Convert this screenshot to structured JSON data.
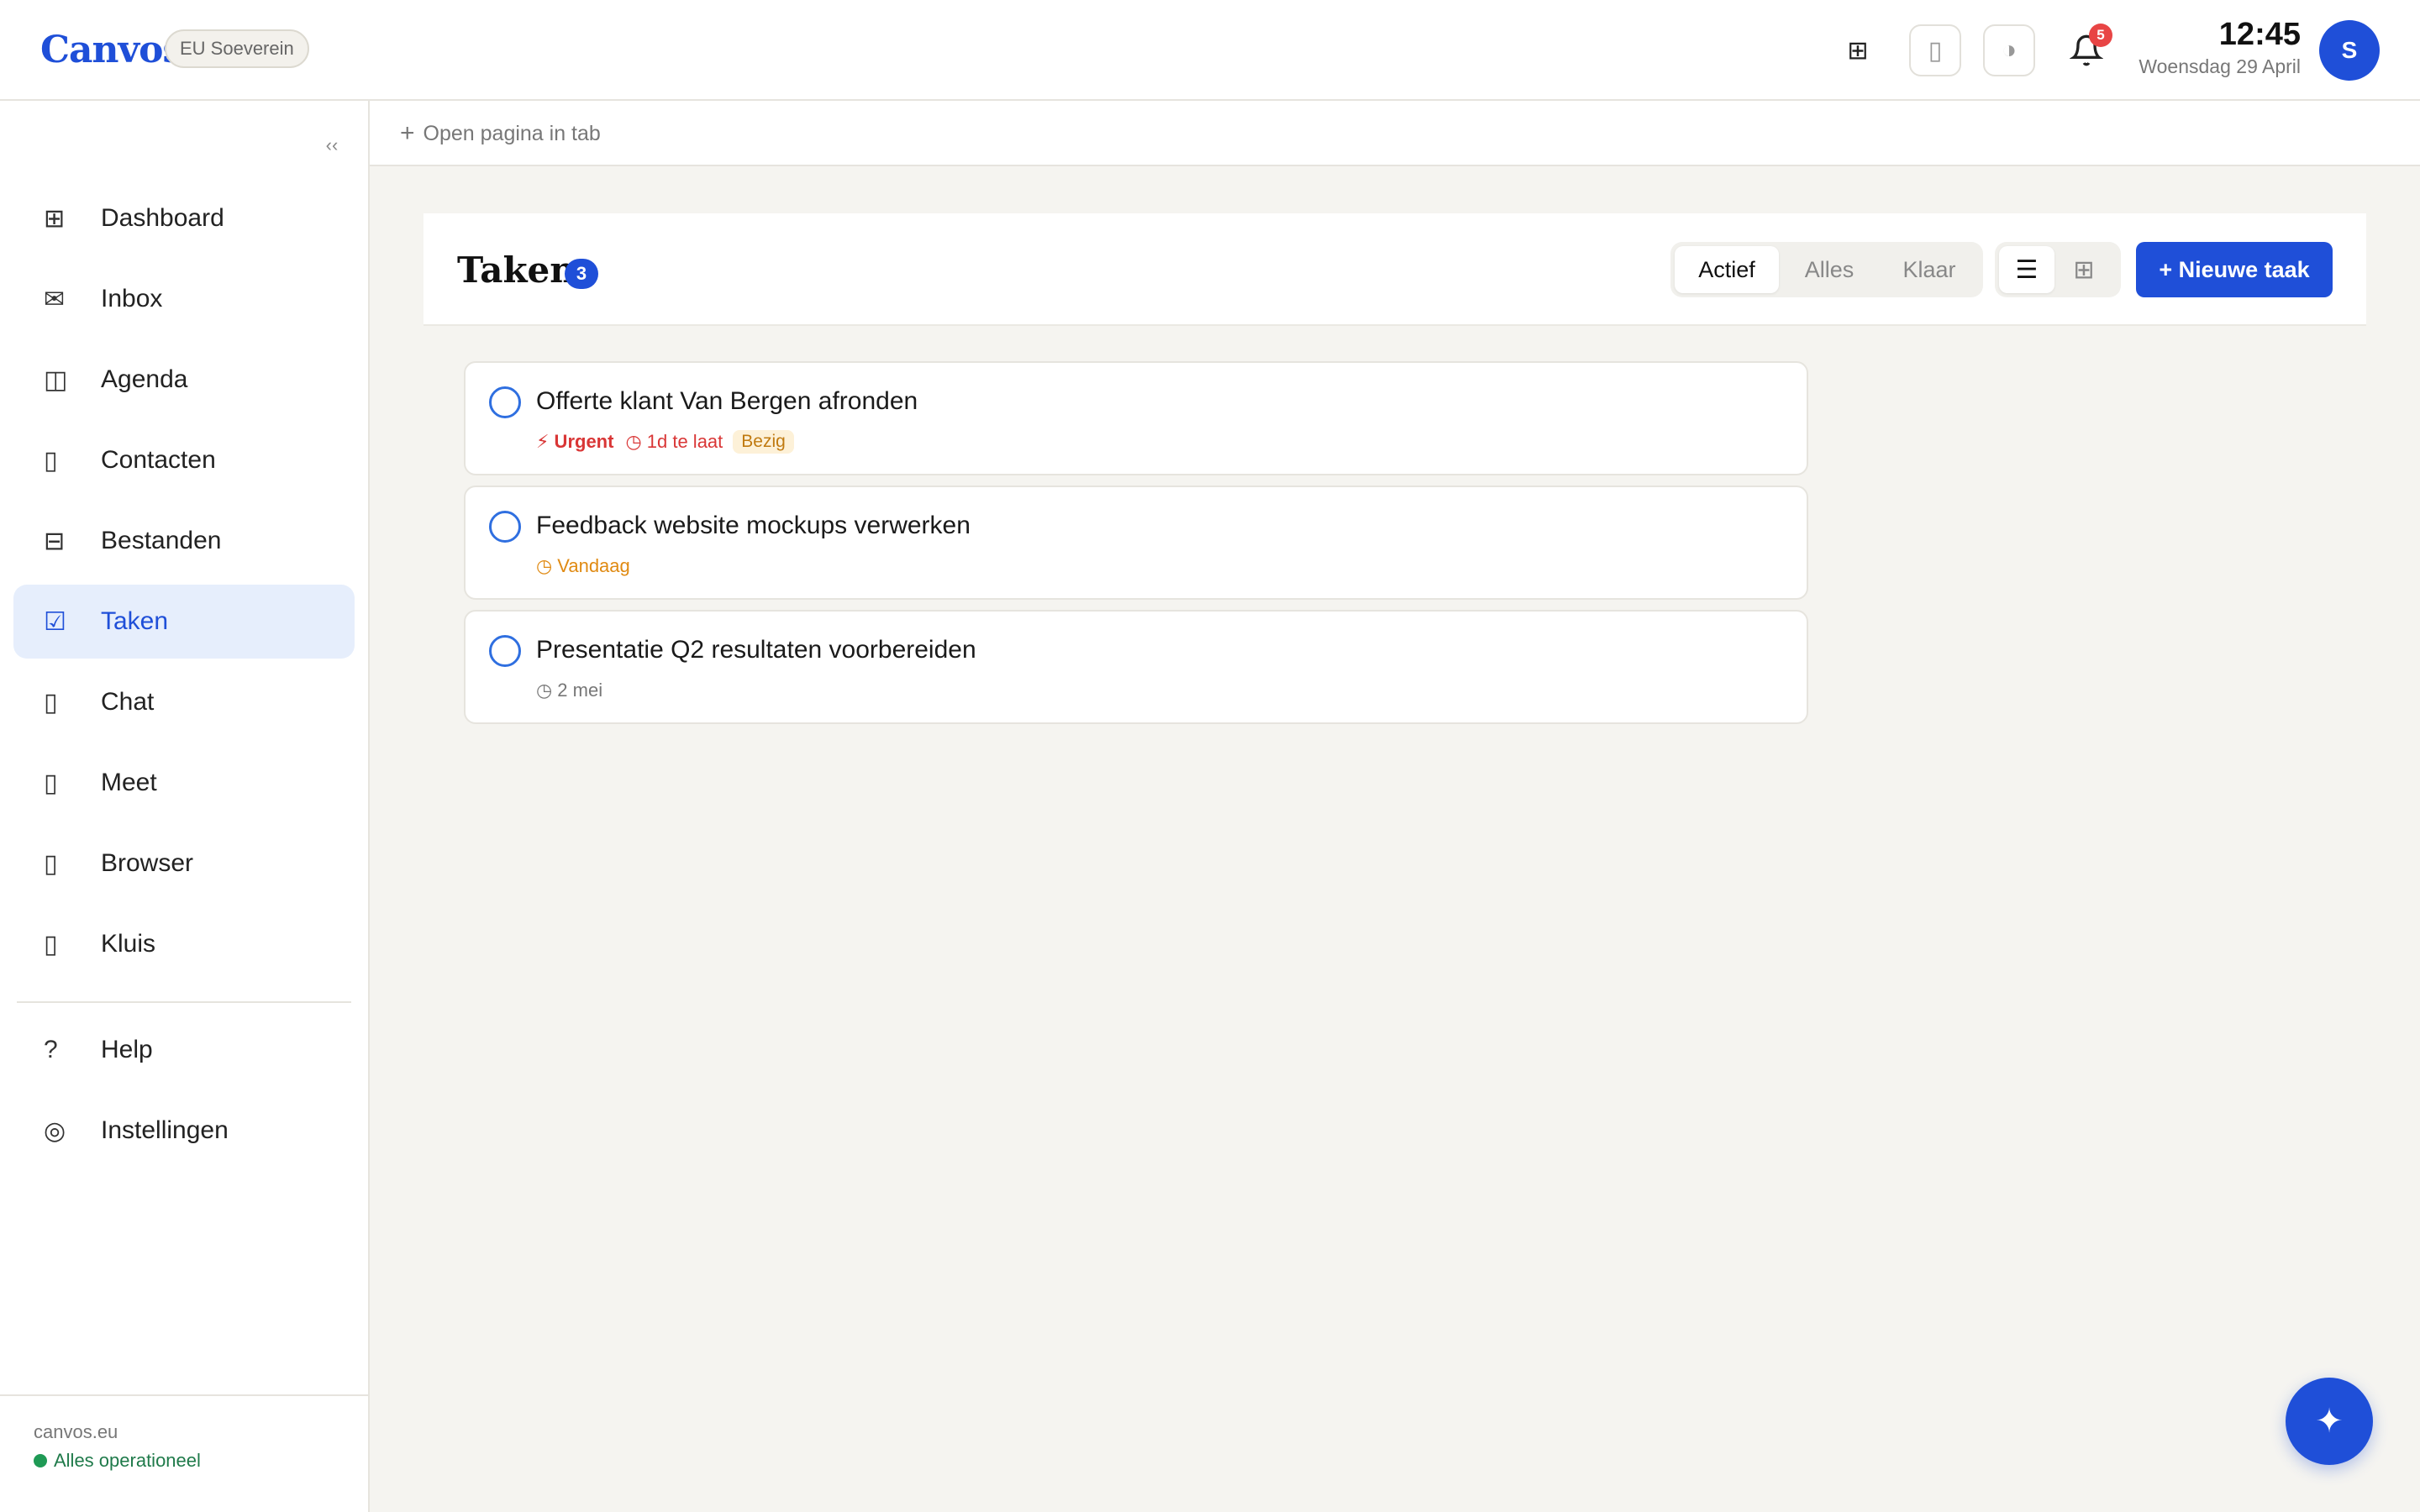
{
  "header": {
    "logo": "Canvos",
    "region_badge": "EU Soeverein",
    "grid_icon": "⊞",
    "device_icon": "▯",
    "contrast_icon": "◑",
    "bell_icon": "🔔",
    "notification_count": "5",
    "time": "12:45",
    "date": "Woensdag 29 April",
    "avatar_initial": "S"
  },
  "sidebar": {
    "collapse_icon": "‹‹",
    "items": [
      {
        "icon": "⊞",
        "label": "Dashboard"
      },
      {
        "icon": "✉",
        "label": "Inbox"
      },
      {
        "icon": "◫",
        "label": "Agenda"
      },
      {
        "icon": "▯",
        "label": "Contacten"
      },
      {
        "icon": "⊟",
        "label": "Bestanden"
      },
      {
        "icon": "☑",
        "label": "Taken"
      },
      {
        "icon": "▯",
        "label": "Chat"
      },
      {
        "icon": "▯",
        "label": "Meet"
      },
      {
        "icon": "▯",
        "label": "Browser"
      },
      {
        "icon": "▯",
        "label": "Kluis"
      }
    ],
    "secondary": [
      {
        "icon": "?",
        "label": "Help"
      },
      {
        "icon": "◎",
        "label": "Instellingen"
      }
    ],
    "footer": {
      "domain": "canvos.eu",
      "status": "Alles operationeel"
    }
  },
  "tabstrip": {
    "plus_icon": "+",
    "open_tab_label": "Open pagina in tab"
  },
  "page": {
    "title": "Taken",
    "count": "3",
    "filters": [
      "Actief",
      "Alles",
      "Klaar"
    ],
    "view_list_icon": "☰",
    "view_grid_icon": "⊞",
    "new_task_label": "+ Nieuwe taak"
  },
  "tasks": [
    {
      "title": "Offerte klant Van Bergen afronden",
      "priority": "⚡ Urgent",
      "due": "◷ 1d te laat",
      "status": "Bezig"
    },
    {
      "title": "Feedback website mockups verwerken",
      "due": "◷ Vandaag"
    },
    {
      "title": "Presentatie Q2 resultaten voorbereiden",
      "due": "◷ 2 mei"
    }
  ],
  "fab_icon": "✦",
  "colors": {
    "accent": "#1f4fd8",
    "urgent": "#d93636",
    "today": "#e08a12",
    "status_ok": "#1f9a55"
  }
}
